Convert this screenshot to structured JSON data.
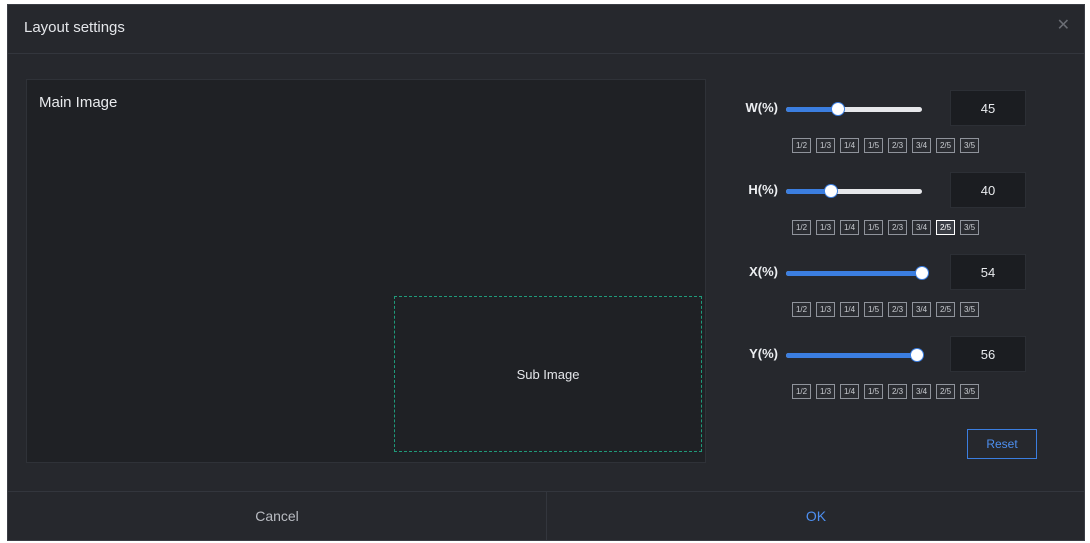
{
  "dialog": {
    "title": "Layout settings",
    "close_icon": "close-icon"
  },
  "preview": {
    "main_label": "Main Image",
    "sub_label": "Sub Image"
  },
  "controls": [
    {
      "key": "w",
      "label": "W(%)",
      "value": "45",
      "fraction": 0.38,
      "active_preset": -1
    },
    {
      "key": "h",
      "label": "H(%)",
      "value": "40",
      "fraction": 0.33,
      "active_preset": 6
    },
    {
      "key": "x",
      "label": "X(%)",
      "value": "54",
      "fraction": 1.0,
      "active_preset": -1
    },
    {
      "key": "y",
      "label": "Y(%)",
      "value": "56",
      "fraction": 0.96,
      "active_preset": -1
    }
  ],
  "presets": [
    "1/2",
    "1/3",
    "1/4",
    "1/5",
    "2/3",
    "3/4",
    "2/5",
    "3/5"
  ],
  "buttons": {
    "reset": "Reset",
    "cancel": "Cancel",
    "ok": "OK"
  },
  "colors": {
    "accent": "#3b7ee0",
    "background": "#26282d",
    "sub_image_border": "#1f9a7a"
  }
}
